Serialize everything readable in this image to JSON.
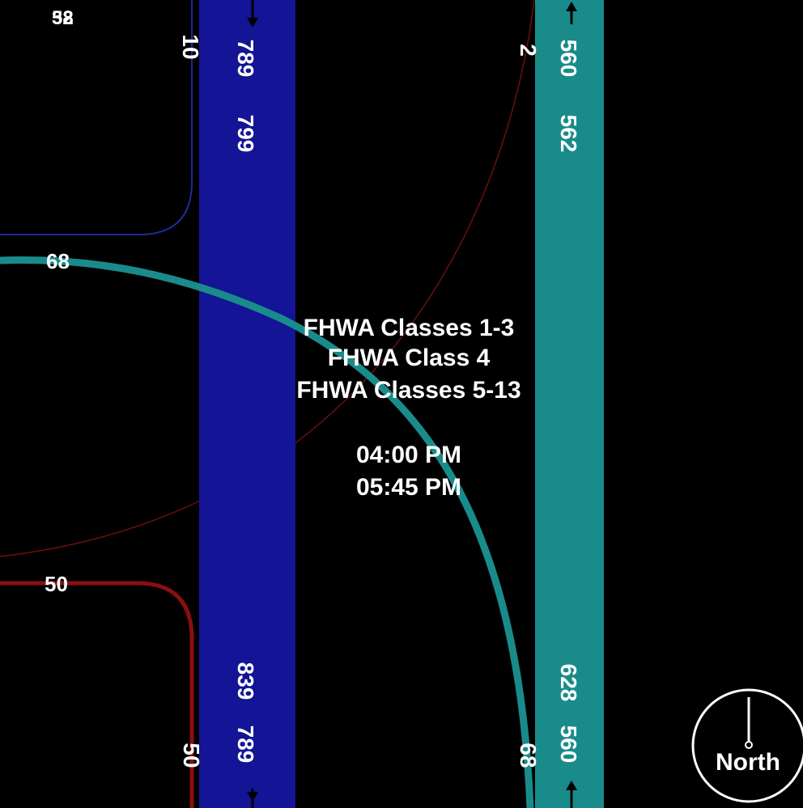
{
  "legend": {
    "line1": "FHWA Classes 1-3",
    "line2": "FHWA Class 4",
    "line3": "FHWA Classes 5-13"
  },
  "time": {
    "start": "04:00 PM",
    "end": "05:45 PM"
  },
  "compass": {
    "label": "North"
  },
  "colors": {
    "southbound_band": "#141496",
    "northbound_band": "#1a8b8b",
    "right_turn_line": "#1a8b8b",
    "left_turn_line": "#8b0f0f",
    "nw_curve": "#1f2a9a",
    "background": "#000000",
    "text": "#ffffff"
  },
  "labels": {
    "top_left_corner_a": "32",
    "top_left_corner_b": "58",
    "sb_right_turn": "10",
    "sb_in_top": "789",
    "sb_out_top": "799",
    "nb_left_turn": "2",
    "nb_in_top": "560",
    "nb_out_top": "562",
    "wb_right_turn": "68",
    "left_turn_volume": "50",
    "sb_out_bottom": "839",
    "sb_in_bottom": "789",
    "sb_left_bottom": "50",
    "nb_right_bottom": "68",
    "nb_out_bottom": "628",
    "nb_in_bottom": "560"
  }
}
